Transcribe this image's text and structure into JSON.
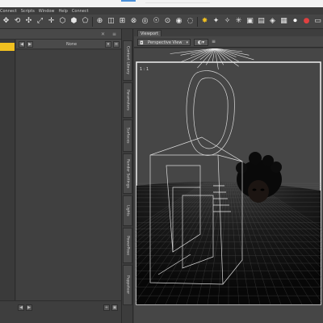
{
  "menubar": {
    "items": [
      "Connect",
      "Scripts",
      "Window",
      "Help",
      "Connect"
    ]
  },
  "toolbar": {
    "icons": [
      "figure-select-icon",
      "rotate-icon",
      "translate-icon",
      "scale-icon",
      "universal-icon",
      "active-pose-icon",
      "joint-editor-icon",
      "geometry-editor-icon",
      "node-weight-icon",
      "surface-selection-icon",
      "region-nav-icon",
      "aim-icon",
      "spot-render-icon",
      "light-icon",
      "camera-icon",
      "node-icon",
      "point-light-icon",
      "distant-light-icon",
      "spotlight-icon",
      "linear-light-icon",
      "render-settings-icon",
      "render-icon",
      "iray-icon",
      "render-camera-icon",
      "render-library-icon"
    ]
  },
  "left_pane": {
    "close_glyph": "✕",
    "menu_glyph": "≡",
    "header": {
      "back_glyph": "◀",
      "forward_glyph": "▶",
      "sort_label": "None",
      "dropdown_glyph": "▾"
    },
    "footer_glyphs": [
      "◀",
      "▶",
      "+",
      "▣"
    ]
  },
  "side_tabs": [
    "Content Library",
    "Parameters",
    "Surfaces",
    "Render Settings",
    "Lights",
    "PowerPose",
    "Puppeteer"
  ],
  "viewport": {
    "tab_label": "Viewport",
    "view_select": "Perspective View",
    "view_chevron": "▾",
    "draw_style_glyph": "◐▾",
    "menu_glyph": "≡",
    "overlay_label": "1 : 1",
    "colors": {
      "floor_dark": "#0e0e0e",
      "background": "#464646",
      "wireframe": "#dcdcdc",
      "frame": "#f0f0f0",
      "accent_yellow": "#f0c020"
    }
  }
}
